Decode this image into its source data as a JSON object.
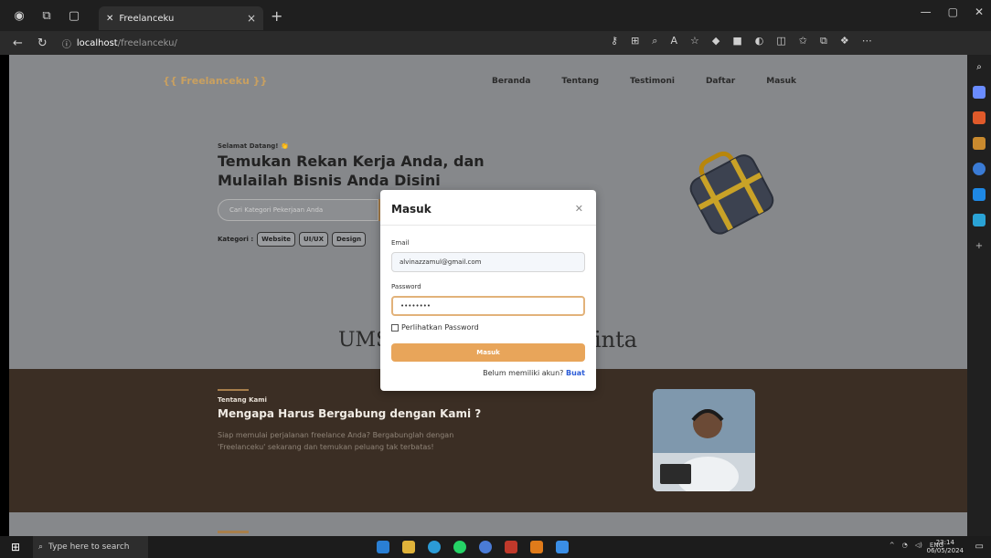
{
  "browser": {
    "tab_title": "Freelanceku",
    "url_host": "localhost",
    "url_path": "/freelanceku/"
  },
  "site": {
    "brand": "{{ Freelanceku }}",
    "menu": [
      "Beranda",
      "Tentang",
      "Testimoni",
      "Daftar",
      "Masuk"
    ],
    "welcome": "Selamat Datang! 👏",
    "headline": "Temukan Rekan Kerja Anda, dan Mulailah Bisnis Anda Disini",
    "search_placeholder": "Cari Kategori Pekerjaan Anda",
    "categories_label": "Kategori :",
    "categories": [
      "Website",
      "UI/UX",
      "Design"
    ],
    "partner_left": "UMS",
    "partner_right": "inta"
  },
  "about": {
    "tag": "Tentang Kami",
    "title": "Mengapa Harus Bergabung dengan Kami ?",
    "text": "Siap memulai perjalanan freelance Anda? Bergabunglah dengan 'Freelanceku' sekarang dan temukan peluang tak terbatas!"
  },
  "modal": {
    "title": "Masuk",
    "email_label": "Email",
    "email_value": "alvinazzamul@gmail.com",
    "password_label": "Password",
    "password_value": "••••••••",
    "show_password": "Perlihatkan Password",
    "login_button": "Masuk",
    "register_prompt": "Belum memiliki akun?",
    "register_link": "Buat"
  },
  "taskbar": {
    "search_placeholder": "Type here to search",
    "tray_lang": "ENG",
    "time": "23:14",
    "date": "06/05/2024"
  }
}
